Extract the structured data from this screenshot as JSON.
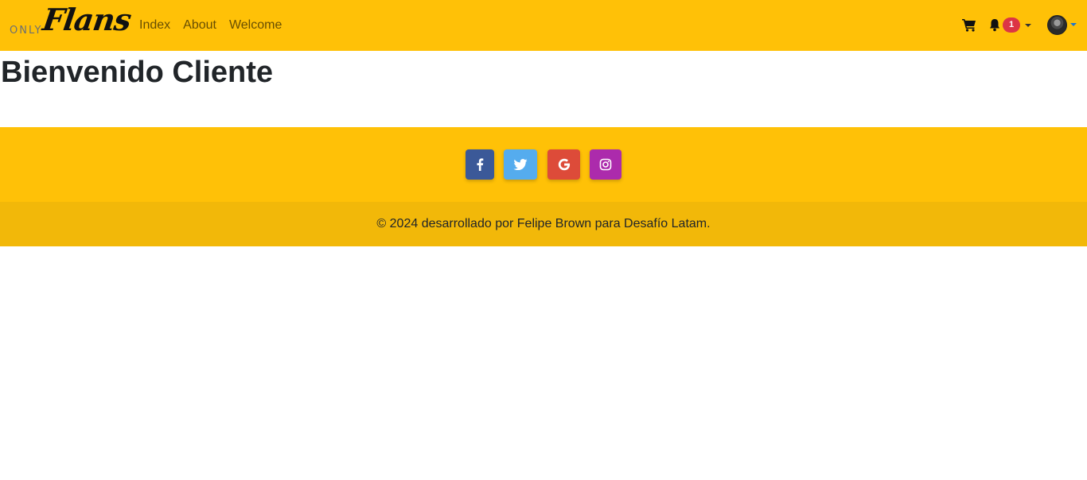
{
  "navbar": {
    "brand": {
      "prefix": "ONLY",
      "script": "Flans"
    },
    "links": [
      "Index",
      "About",
      "Welcome"
    ],
    "cart_icon": "shopping-cart-icon",
    "notifications": {
      "icon": "bell-icon",
      "count": "1"
    },
    "profile": {
      "icon": "avatar"
    },
    "colors": {
      "background": "#ffc107",
      "badge": "#dc3545"
    }
  },
  "main": {
    "title": "Bienvenido Cliente"
  },
  "footer": {
    "social": [
      {
        "name": "facebook",
        "icon": "facebook-icon",
        "color": "#3b5998"
      },
      {
        "name": "twitter",
        "icon": "twitter-icon",
        "color": "#55acee"
      },
      {
        "name": "google",
        "icon": "google-icon",
        "color": "#dd4b39"
      },
      {
        "name": "instagram",
        "icon": "instagram-icon",
        "color": "#ac2bac"
      }
    ],
    "copyright": "© 2024 desarrollado por Felipe Brown para Desafío Latam.",
    "colors": {
      "top": "#ffc107",
      "bottom": "#f2b809"
    }
  }
}
